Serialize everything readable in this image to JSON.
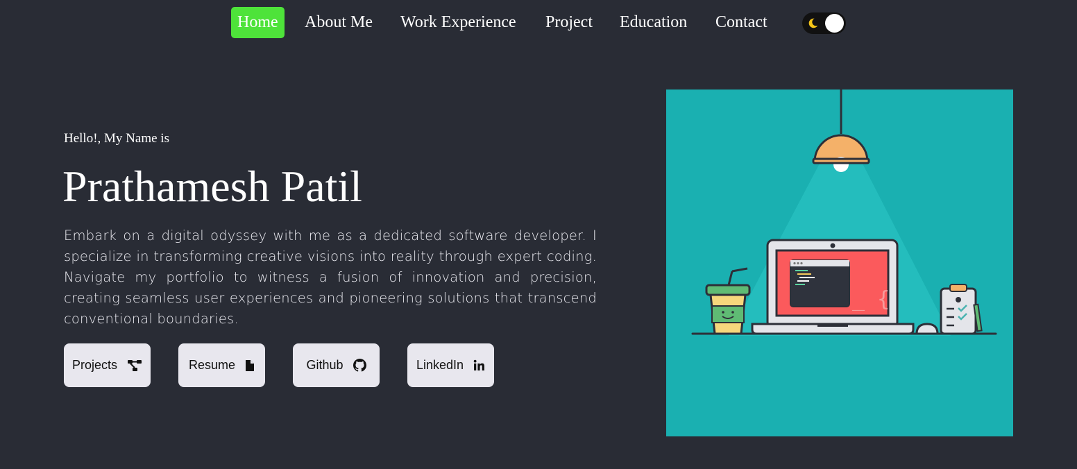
{
  "nav": {
    "items": [
      {
        "label": "Home",
        "active": true
      },
      {
        "label": "About Me"
      },
      {
        "label": "Work Experience"
      },
      {
        "label": "Project"
      },
      {
        "label": "Education"
      },
      {
        "label": "Contact"
      }
    ],
    "theme_toggle": {
      "icon": "moon-icon",
      "state": "dark"
    }
  },
  "hero": {
    "greeting": "Hello!, My Name is",
    "name": "Prathamesh Patil",
    "intro": "Embark on a digital odyssey with me as a dedicated software developer. I specialize in transforming creative visions into reality through expert coding. Navigate my portfolio to witness a fusion of innovation and precision, creating seamless user experiences and pioneering solutions that transcend conventional boundaries."
  },
  "buttons": [
    {
      "label": "Projects",
      "icon": "project-diagram-icon"
    },
    {
      "label": "Resume",
      "icon": "file-icon"
    },
    {
      "label": "Github",
      "icon": "github-icon"
    },
    {
      "label": "LinkedIn",
      "icon": "linkedin-icon"
    }
  ],
  "colors": {
    "background": "#292c35",
    "active_nav": "#4ee33a",
    "button_bg": "#e8e7ee",
    "illustration_bg": "#1ab0b1"
  }
}
